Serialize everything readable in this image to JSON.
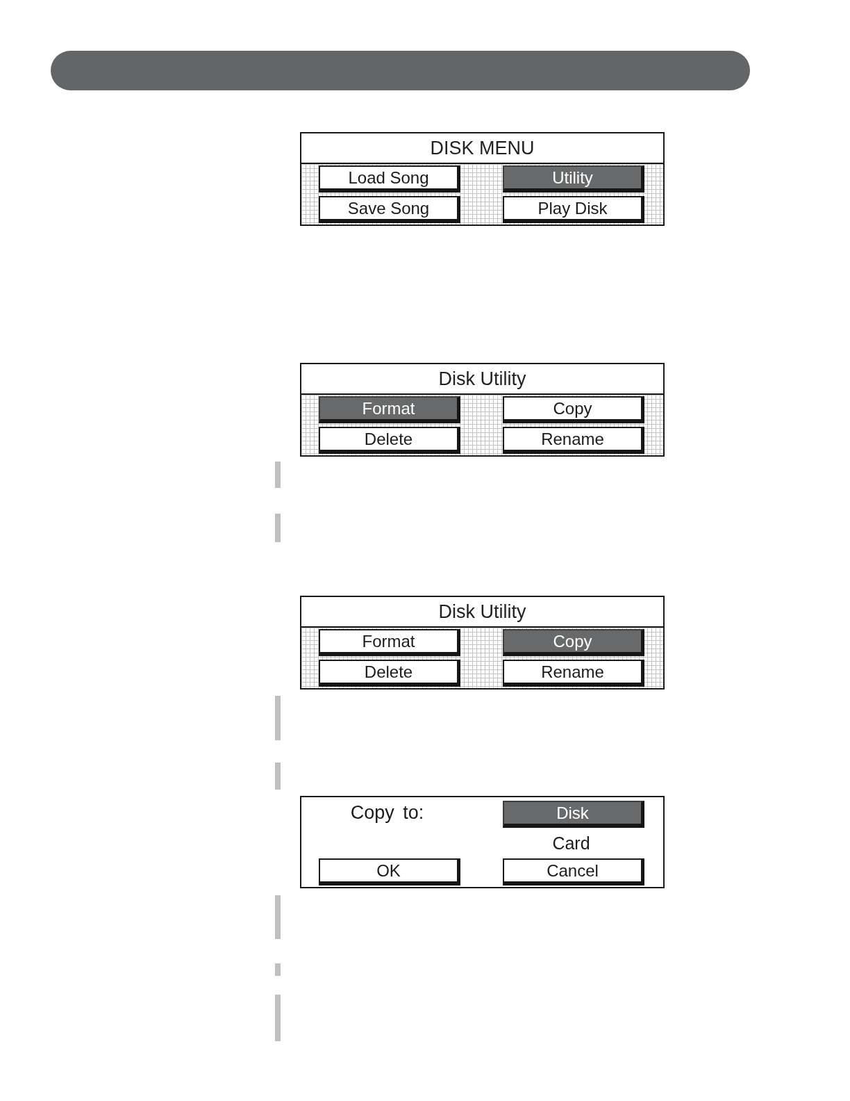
{
  "screens": [
    {
      "kind": "menu",
      "title": "DISK MENU",
      "buttons": [
        {
          "label": "Load Song",
          "selected": false
        },
        {
          "label": "Utility",
          "selected": true
        },
        {
          "label": "Save Song",
          "selected": false
        },
        {
          "label": "Play Disk",
          "selected": false
        }
      ]
    },
    {
      "kind": "menu",
      "title": "Disk Utility",
      "buttons": [
        {
          "label": "Format",
          "selected": true
        },
        {
          "label": "Copy",
          "selected": false
        },
        {
          "label": "Delete",
          "selected": false
        },
        {
          "label": "Rename",
          "selected": false
        }
      ]
    },
    {
      "kind": "menu",
      "title": "Disk Utility",
      "buttons": [
        {
          "label": "Format",
          "selected": false
        },
        {
          "label": "Copy",
          "selected": true
        },
        {
          "label": "Delete",
          "selected": false
        },
        {
          "label": "Rename",
          "selected": false
        }
      ]
    },
    {
      "kind": "dialog",
      "prompt": "Copy to:",
      "options": [
        {
          "label": "Disk",
          "selected": true
        },
        {
          "label": "Card",
          "selected": false
        }
      ],
      "buttons": [
        "OK",
        "Cancel"
      ]
    }
  ]
}
